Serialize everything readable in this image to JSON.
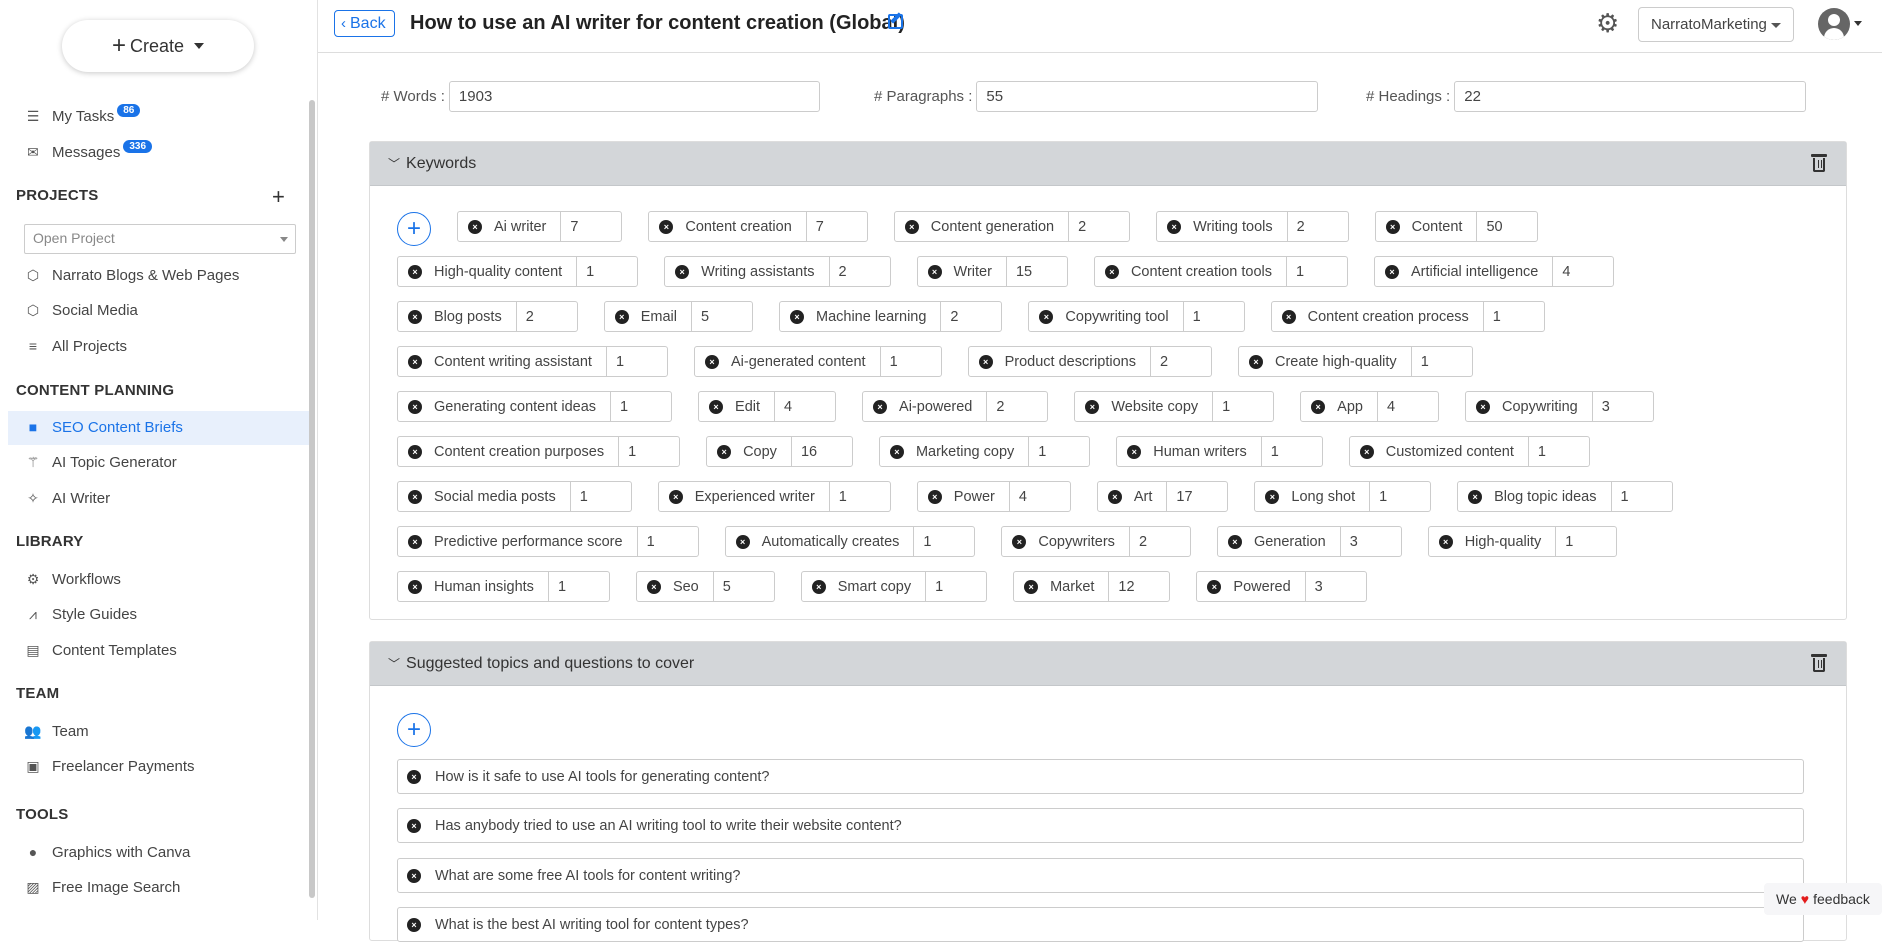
{
  "sidebar": {
    "create_label": "Create",
    "my_tasks": {
      "label": "My Tasks",
      "badge": "86",
      "icon": "tasks-icon"
    },
    "messages": {
      "label": "Messages",
      "badge": "336",
      "icon": "envelope-icon"
    },
    "projects_title": "PROJECTS",
    "open_project_placeholder": "Open Project",
    "projects": [
      {
        "label": "Narrato Blogs & Web Pages",
        "icon": "cube-icon"
      },
      {
        "label": "Social Media",
        "icon": "cube-icon"
      },
      {
        "label": "All Projects",
        "icon": "list-icon"
      }
    ],
    "content_planning_title": "CONTENT PLANNING",
    "content_planning": [
      {
        "label": "SEO Content Briefs",
        "icon": "note-icon",
        "active": true
      },
      {
        "label": "AI Topic Generator",
        "icon": "magic-wand-icon"
      },
      {
        "label": "AI Writer",
        "icon": "wand-sparkles-icon"
      }
    ],
    "library_title": "LIBRARY",
    "library": [
      {
        "label": "Workflows",
        "icon": "gears-icon"
      },
      {
        "label": "Style Guides",
        "icon": "compass-icon"
      },
      {
        "label": "Content Templates",
        "icon": "file-icon"
      }
    ],
    "team_title": "TEAM",
    "team": [
      {
        "label": "Team",
        "icon": "users-icon"
      },
      {
        "label": "Freelancer Payments",
        "icon": "money-icon"
      }
    ],
    "tools_title": "TOOLS",
    "tools": [
      {
        "label": "Graphics with Canva",
        "icon": "canva-icon"
      },
      {
        "label": "Free Image Search",
        "icon": "image-icon"
      }
    ]
  },
  "header": {
    "back_label": "Back",
    "title": "How to use an AI writer for content creation (Global)",
    "account": "NarratoMarketing"
  },
  "stats": {
    "words_label": "# Words :",
    "words": "1903",
    "paragraphs_label": "# Paragraphs :",
    "paragraphs": "55",
    "headings_label": "# Headings :",
    "headings": "22"
  },
  "keywords": {
    "title": "Keywords",
    "rows": [
      [
        [
          "Ai writer",
          "7"
        ],
        [
          "Content creation",
          "7"
        ],
        [
          "Content generation",
          "2"
        ],
        [
          "Writing tools",
          "2"
        ],
        [
          "Content",
          "50"
        ]
      ],
      [
        [
          "High-quality content",
          "1"
        ],
        [
          "Writing assistants",
          "2"
        ],
        [
          "Writer",
          "15"
        ],
        [
          "Content creation tools",
          "1"
        ],
        [
          "Artificial intelligence",
          "4"
        ]
      ],
      [
        [
          "Blog posts",
          "2"
        ],
        [
          "Email",
          "5"
        ],
        [
          "Machine learning",
          "2"
        ],
        [
          "Copywriting tool",
          "1"
        ],
        [
          "Content creation process",
          "1"
        ]
      ],
      [
        [
          "Content writing assistant",
          "1"
        ],
        [
          "Ai-generated content",
          "1"
        ],
        [
          "Product descriptions",
          "2"
        ],
        [
          "Create high-quality",
          "1"
        ]
      ],
      [
        [
          "Generating content ideas",
          "1"
        ],
        [
          "Edit",
          "4"
        ],
        [
          "Ai-powered",
          "2"
        ],
        [
          "Website copy",
          "1"
        ],
        [
          "App",
          "4"
        ],
        [
          "Copywriting",
          "3"
        ]
      ],
      [
        [
          "Content creation purposes",
          "1"
        ],
        [
          "Copy",
          "16"
        ],
        [
          "Marketing copy",
          "1"
        ],
        [
          "Human writers",
          "1"
        ],
        [
          "Customized content",
          "1"
        ]
      ],
      [
        [
          "Social media posts",
          "1"
        ],
        [
          "Experienced writer",
          "1"
        ],
        [
          "Power",
          "4"
        ],
        [
          "Art",
          "17"
        ],
        [
          "Long shot",
          "1"
        ],
        [
          "Blog topic ideas",
          "1"
        ]
      ],
      [
        [
          "Predictive performance score",
          "1"
        ],
        [
          "Automatically creates",
          "1"
        ],
        [
          "Copywriters",
          "2"
        ],
        [
          "Generation",
          "3"
        ],
        [
          "High-quality",
          "1"
        ]
      ],
      [
        [
          "Human insights",
          "1"
        ],
        [
          "Seo",
          "5"
        ],
        [
          "Smart copy",
          "1"
        ],
        [
          "Market",
          "12"
        ],
        [
          "Powered",
          "3"
        ]
      ]
    ]
  },
  "topics": {
    "title": "Suggested topics and questions to cover",
    "items": [
      "How is it safe to use AI tools for generating content?",
      "Has anybody tried to use an AI writing tool to write their website content?",
      "What are some free AI tools for content writing?",
      "What is the best AI writing tool for content types?"
    ]
  },
  "feedback": {
    "pre": "We",
    "post": "feedback"
  }
}
